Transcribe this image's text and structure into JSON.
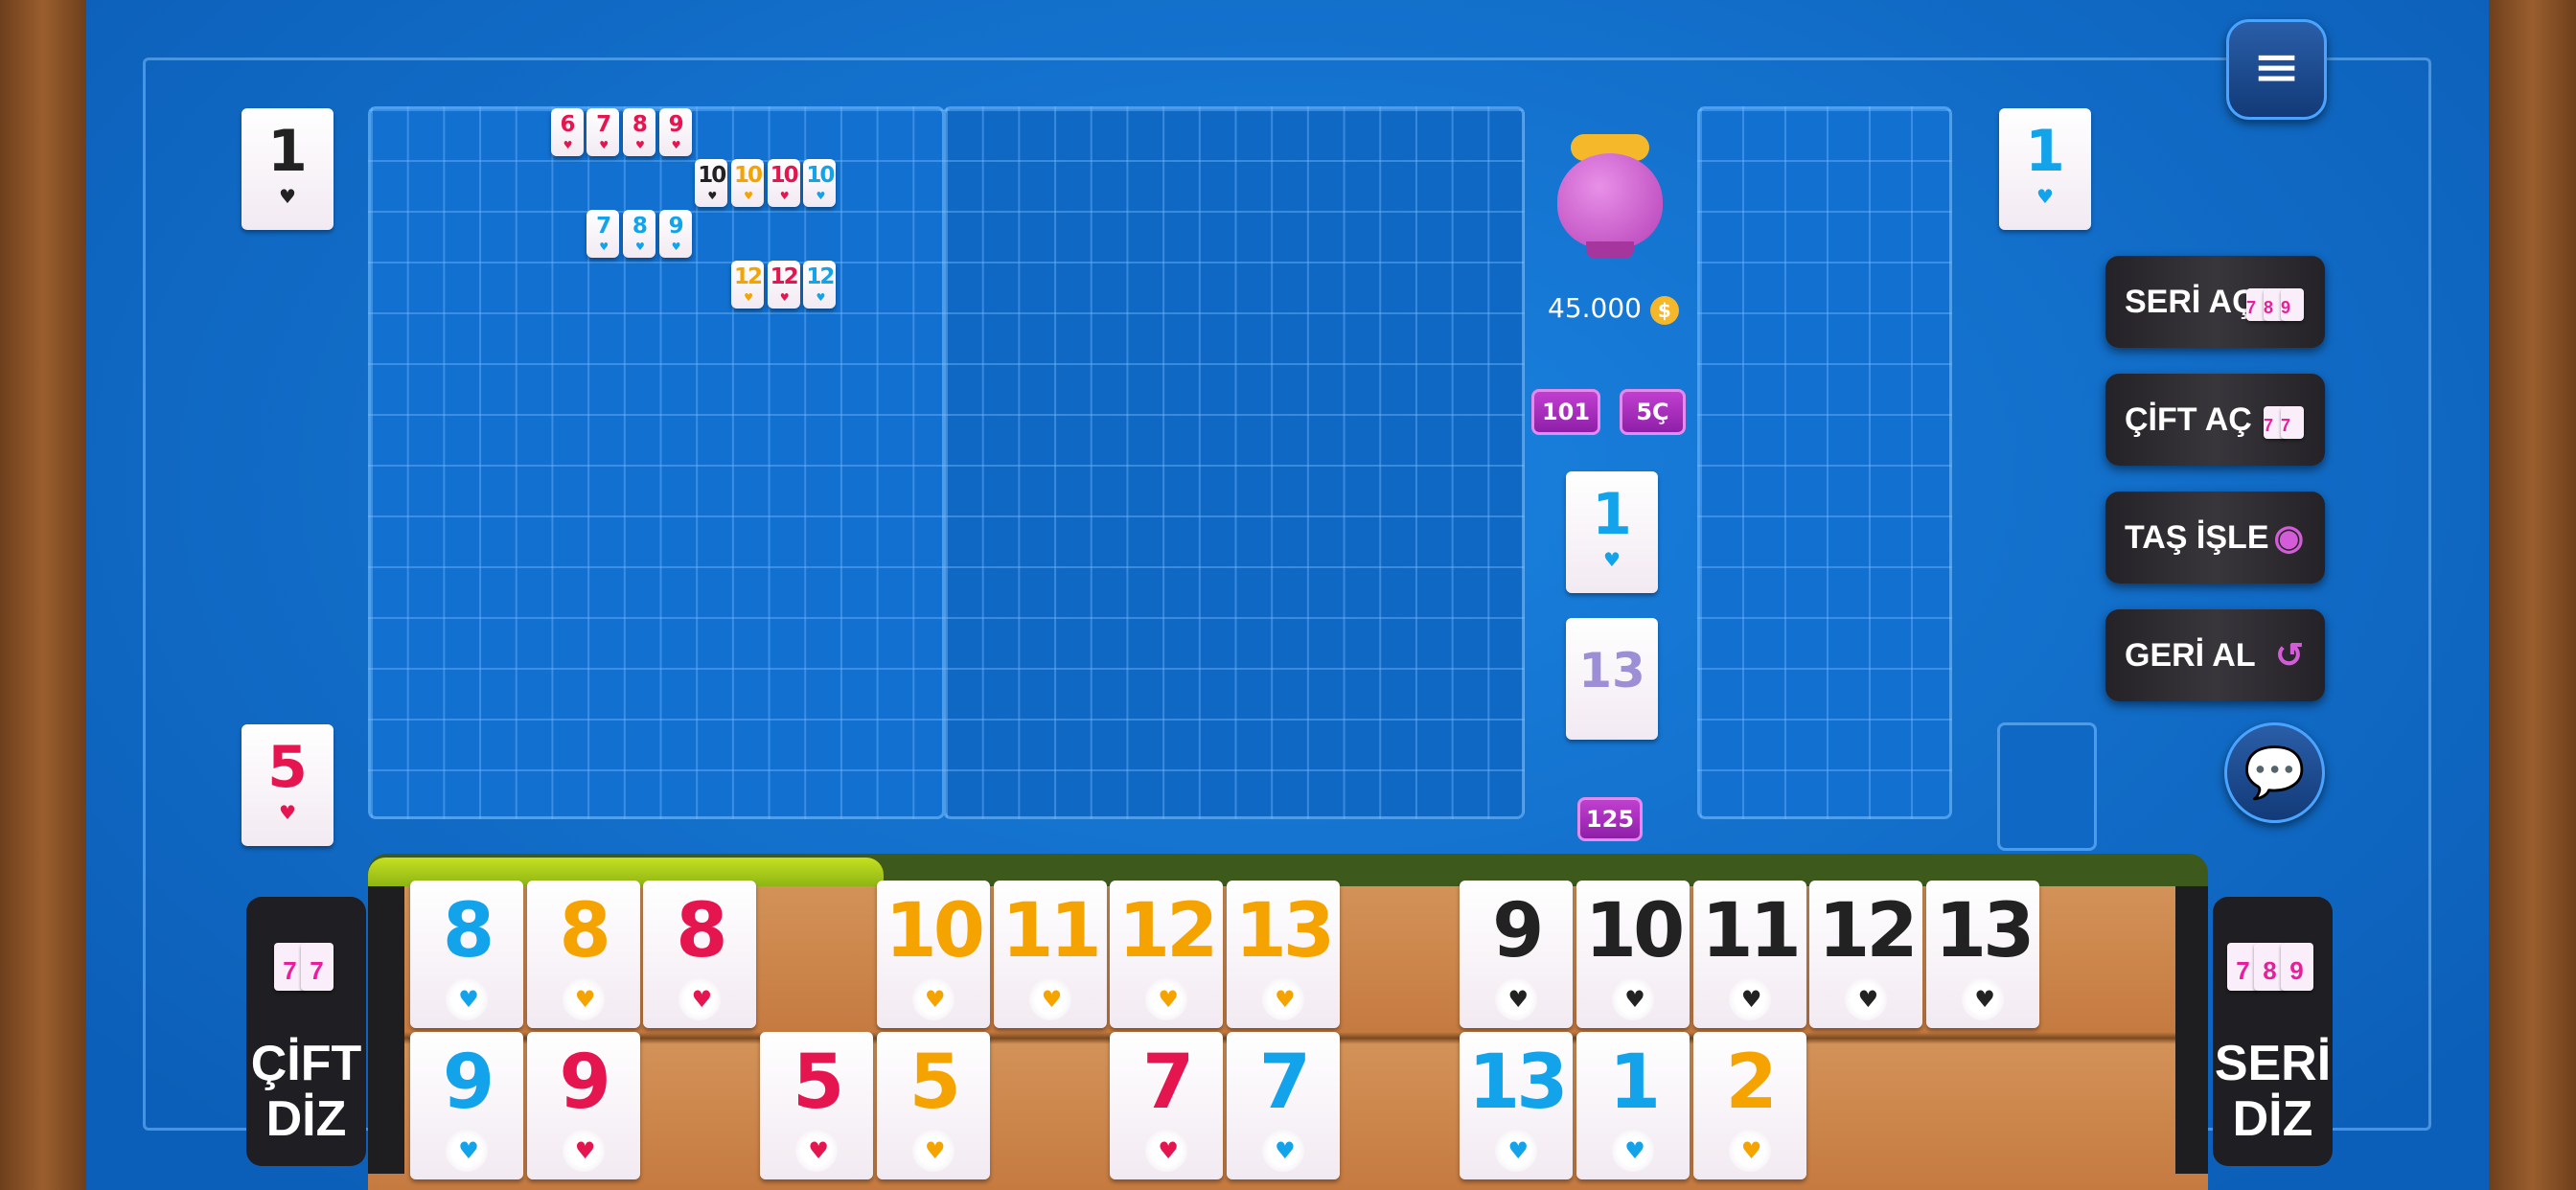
{
  "colors": {
    "red": "#e5154f",
    "orange": "#f4a300",
    "blue": "#13a3ea",
    "black": "#222222",
    "accent": "#c13fd0",
    "table": "#1170d0"
  },
  "left_player": {
    "discard_tile": {
      "number": "1",
      "color": "black"
    },
    "bottom_tile": {
      "number": "5",
      "color": "red"
    }
  },
  "right_player": {
    "discard_tile": {
      "number": "1",
      "color": "blue"
    }
  },
  "board": {
    "melds": [
      {
        "row": 0,
        "col": 5,
        "tiles": [
          {
            "number": "6",
            "color": "red"
          },
          {
            "number": "7",
            "color": "red"
          },
          {
            "number": "8",
            "color": "red"
          },
          {
            "number": "9",
            "color": "red"
          }
        ]
      },
      {
        "row": 1,
        "col": 9,
        "tiles": [
          {
            "number": "10",
            "color": "black"
          },
          {
            "number": "10",
            "color": "orange"
          },
          {
            "number": "10",
            "color": "red"
          },
          {
            "number": "10",
            "color": "blue"
          }
        ]
      },
      {
        "row": 2,
        "col": 6,
        "tiles": [
          {
            "number": "7",
            "color": "blue"
          },
          {
            "number": "8",
            "color": "blue"
          },
          {
            "number": "9",
            "color": "blue"
          }
        ]
      },
      {
        "row": 3,
        "col": 10,
        "tiles": [
          {
            "number": "12",
            "color": "orange"
          },
          {
            "number": "12",
            "color": "red"
          },
          {
            "number": "12",
            "color": "blue"
          }
        ]
      }
    ]
  },
  "pot": {
    "amount": "45.000",
    "coin_icon": "coin-icon"
  },
  "mode_tags": [
    "101",
    "5Ç"
  ],
  "center": {
    "indicator_tile": {
      "number": "1",
      "color": "blue"
    },
    "draw_pile_tile": {
      "number": "13",
      "color": "lav"
    },
    "remaining_count": "125"
  },
  "actions": [
    {
      "label": "SERİ AÇ",
      "icon": "tiles-789-icon"
    },
    {
      "label": "ÇİFT AÇ",
      "icon": "tiles-77-icon"
    },
    {
      "label": "TAŞ İŞLE",
      "icon": "target-icon"
    },
    {
      "label": "GERİ AL",
      "icon": "undo-icon"
    }
  ],
  "side_buttons": {
    "left": {
      "line1": "ÇİFT",
      "line2": "DİZ"
    },
    "right": {
      "line1": "SERİ",
      "line2": "DİZ"
    }
  },
  "rack": {
    "row1": [
      {
        "number": "8",
        "color": "blue"
      },
      {
        "number": "8",
        "color": "orange"
      },
      {
        "number": "8",
        "color": "red"
      },
      null,
      {
        "number": "10",
        "color": "orange"
      },
      {
        "number": "11",
        "color": "orange"
      },
      {
        "number": "12",
        "color": "orange"
      },
      {
        "number": "13",
        "color": "orange"
      },
      null,
      {
        "number": "9",
        "color": "black"
      },
      {
        "number": "10",
        "color": "black"
      },
      {
        "number": "11",
        "color": "black"
      },
      {
        "number": "12",
        "color": "black"
      },
      {
        "number": "13",
        "color": "black"
      }
    ],
    "row2": [
      {
        "number": "9",
        "color": "blue"
      },
      {
        "number": "9",
        "color": "red"
      },
      null,
      {
        "number": "5",
        "color": "red"
      },
      {
        "number": "5",
        "color": "orange"
      },
      null,
      {
        "number": "7",
        "color": "red"
      },
      {
        "number": "7",
        "color": "blue"
      },
      null,
      {
        "number": "13",
        "color": "blue"
      },
      {
        "number": "1",
        "color": "blue"
      },
      {
        "number": "2",
        "color": "orange"
      }
    ]
  },
  "turn_progress": 0.28
}
